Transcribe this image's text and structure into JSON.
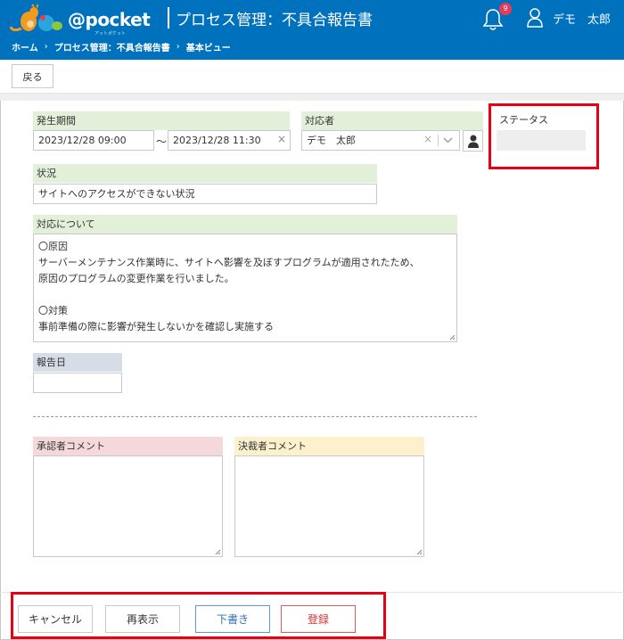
{
  "header": {
    "logo_text": "@pocket",
    "logo_subtext": "アットポケット",
    "app_title": "プロセス管理：不具合報告書",
    "notification_count": "9",
    "user_name": "デモ　太郎",
    "brand_color": "#0071bc"
  },
  "breadcrumb": {
    "items": [
      "ホーム",
      "プロセス管理：不具合報告書",
      "基本ビュー"
    ]
  },
  "toolbar": {
    "back_label": "戻る"
  },
  "form": {
    "period": {
      "label": "発生期間",
      "start": "2023/12/28 09:00",
      "separator": "～",
      "end": "2023/12/28 11:30"
    },
    "handler": {
      "label": "対応者",
      "value": "デモ　太郎"
    },
    "status": {
      "label": "ステータス",
      "value": ""
    },
    "situation": {
      "label": "状況",
      "value": "サイトへのアクセスができない状況"
    },
    "response": {
      "label": "対応について",
      "value": "〇原因\nサーバーメンテナンス作業時に、サイトへ影響を及ぼすプログラムが適用されたため、\n原因のプログラムの変更作業を行いました。\n\n〇対策\n事前準備の際に影響が発生しないかを確認し実施する"
    },
    "report_date": {
      "label": "報告日",
      "value": ""
    },
    "approver_comment": {
      "label": "承認者コメント",
      "value": ""
    },
    "decider_comment": {
      "label": "決裁者コメント",
      "value": ""
    }
  },
  "actions": {
    "cancel": "キャンセル",
    "reload": "再表示",
    "draft": "下書き",
    "submit": "登録"
  },
  "icons": {
    "clear": "×",
    "chevron": "chevron-down-icon",
    "person": "person-icon",
    "bell": "bell-icon",
    "user": "user-icon"
  }
}
